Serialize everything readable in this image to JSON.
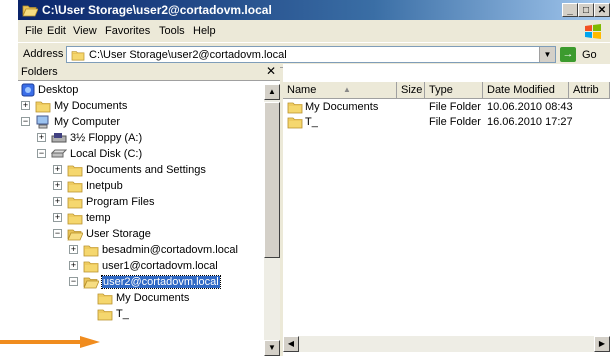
{
  "window": {
    "title": "C:\\User Storage\\user2@cortadovm.local"
  },
  "menu": [
    "File",
    "Edit",
    "View",
    "Favorites",
    "Tools",
    "Help"
  ],
  "address": {
    "label": "Address",
    "value": "C:\\User Storage\\user2@cortadovm.local",
    "go_label": "Go"
  },
  "folders_panel": {
    "header": "Folders",
    "close": "✕",
    "tree": [
      {
        "label": "Desktop"
      },
      {
        "label": "My Documents"
      },
      {
        "label": "My Computer"
      },
      {
        "label": "3½ Floppy (A:)"
      },
      {
        "label": "Local Disk (C:)"
      },
      {
        "label": "Documents and Settings"
      },
      {
        "label": "Inetpub"
      },
      {
        "label": "Program Files"
      },
      {
        "label": "temp"
      },
      {
        "label": "User Storage"
      },
      {
        "label": "besadmin@cortadovm.local"
      },
      {
        "label": "user1@cortadovm.local"
      },
      {
        "label": "user2@cortadovm.local"
      },
      {
        "label": "My Documents"
      },
      {
        "label": "T_"
      }
    ]
  },
  "files": {
    "columns": [
      "Name",
      "Size",
      "Type",
      "Date Modified",
      "Attrib"
    ],
    "sort_indicator": "▲",
    "rows": [
      {
        "name": "My Documents",
        "size": "",
        "type": "File Folder",
        "modified": "10.06.2010 08:43"
      },
      {
        "name": "T_",
        "size": "",
        "type": "File Folder",
        "modified": "16.06.2010 17:27"
      }
    ]
  },
  "colors": {
    "arrow": "#f08c1e",
    "selection": "#316ac5",
    "folder": "#f5d76e"
  }
}
